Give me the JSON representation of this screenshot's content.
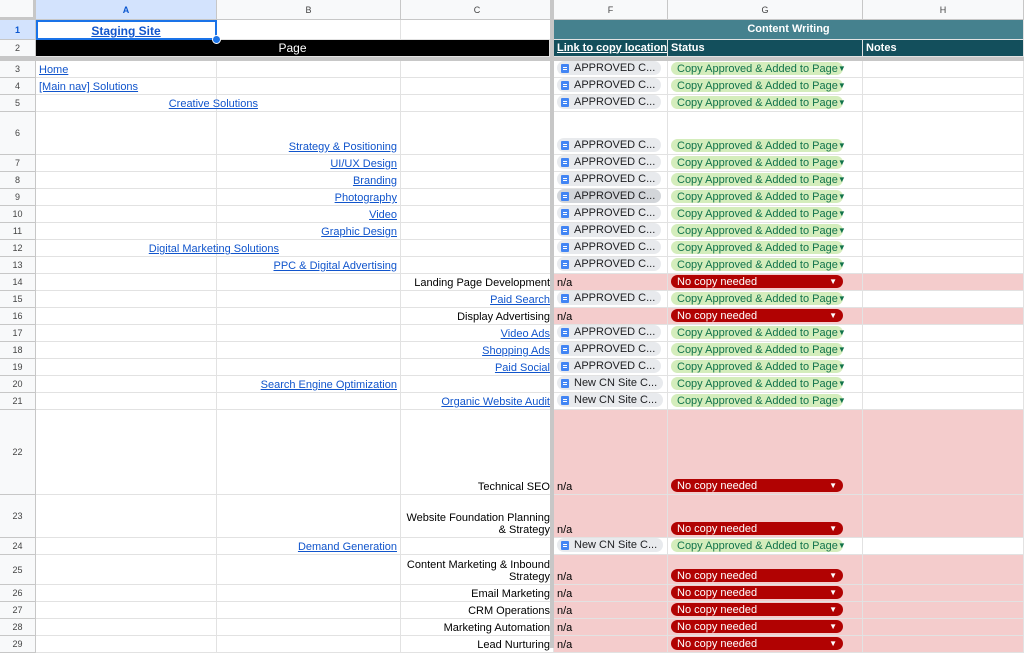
{
  "colors": {
    "header_teal": "#134f5c",
    "header_teal_light": "#45818e",
    "pink": "#f4cccc",
    "green_chip": "#d4edbc",
    "red_chip": "#b10202"
  },
  "columns": [
    "A",
    "B",
    "C",
    "F",
    "G",
    "H"
  ],
  "header": {
    "staging_site": "Staging Site",
    "page": "Page",
    "content_writing": "Content Writing",
    "link_to_copy": "Link to copy location",
    "status": "Status",
    "notes": "Notes"
  },
  "rows": [
    {
      "num": "3",
      "a": "Home",
      "b": "",
      "c": "",
      "link": "APPROVED C...",
      "status": "Copy Approved & Added to Page",
      "kind": "ok"
    },
    {
      "num": "4",
      "a": "[Main nav] Solutions",
      "b": "",
      "c": "",
      "link": "APPROVED C...",
      "status": "Copy Approved & Added to Page",
      "kind": "ok"
    },
    {
      "num": "5",
      "a": "Creative Solutions",
      "b": "",
      "c": "",
      "link": "APPROVED C...",
      "status": "Copy Approved & Added to Page",
      "kind": "ok"
    },
    {
      "num": "6",
      "a": "",
      "b": "Strategy & Positioning",
      "c": "",
      "link": "APPROVED C...",
      "status": "Copy Approved & Added to Page",
      "kind": "ok"
    },
    {
      "num": "7",
      "a": "",
      "b": "UI/UX Design",
      "c": "",
      "link": "APPROVED C...",
      "status": "Copy Approved & Added to Page",
      "kind": "ok"
    },
    {
      "num": "8",
      "a": "",
      "b": "Branding",
      "c": "",
      "link": "APPROVED C...",
      "status": "Copy Approved & Added to Page",
      "kind": "ok"
    },
    {
      "num": "9",
      "a": "",
      "b": "Photography",
      "c": "",
      "link": "APPROVED C...",
      "status": "Copy Approved & Added to Page",
      "kind": "ok"
    },
    {
      "num": "10",
      "a": "",
      "b": "Video",
      "c": "",
      "link": "APPROVED C...",
      "status": "Copy Approved & Added to Page",
      "kind": "ok"
    },
    {
      "num": "11",
      "a": "",
      "b": "Graphic Design",
      "c": "",
      "link": "APPROVED C...",
      "status": "Copy Approved & Added to Page",
      "kind": "ok"
    },
    {
      "num": "12",
      "a": "Digital Marketing Solutions",
      "b": "",
      "c": "",
      "link": "APPROVED C...",
      "status": "Copy Approved & Added to Page",
      "kind": "ok"
    },
    {
      "num": "13",
      "a": "",
      "b": "PPC & Digital Advertising",
      "c": "",
      "link": "APPROVED C...",
      "status": "Copy Approved & Added to Page",
      "kind": "ok"
    },
    {
      "num": "14",
      "a": "",
      "b": "",
      "c": "Landing Page Development",
      "link": "n/a",
      "status": "No copy needed",
      "kind": "no"
    },
    {
      "num": "15",
      "a": "",
      "b": "",
      "c": "Paid Search",
      "link": "APPROVED C...",
      "status": "Copy Approved & Added to Page",
      "kind": "ok"
    },
    {
      "num": "16",
      "a": "",
      "b": "",
      "c": "Display Advertising",
      "link": "n/a",
      "status": "No copy needed",
      "kind": "no"
    },
    {
      "num": "17",
      "a": "",
      "b": "",
      "c": "Video Ads",
      "link": "APPROVED C...",
      "status": "Copy Approved & Added to Page",
      "kind": "ok"
    },
    {
      "num": "18",
      "a": "",
      "b": "",
      "c": "Shopping Ads",
      "link": "APPROVED C...",
      "status": "Copy Approved & Added to Page",
      "kind": "ok"
    },
    {
      "num": "19",
      "a": "",
      "b": "",
      "c": "Paid Social",
      "link": "APPROVED C...",
      "status": "Copy Approved & Added to Page",
      "kind": "ok"
    },
    {
      "num": "20",
      "a": "",
      "b": "Search Engine Optimization",
      "c": "",
      "link": "New CN Site C...",
      "status": "Copy Approved & Added to Page",
      "kind": "ok"
    },
    {
      "num": "21",
      "a": "",
      "b": "",
      "c": "Organic Website Audit",
      "link": "New CN Site C...",
      "status": "Copy Approved & Added to Page",
      "kind": "ok"
    },
    {
      "num": "22",
      "a": "",
      "b": "",
      "c": "Technical SEO",
      "link": "n/a",
      "status": "No copy needed",
      "kind": "no"
    },
    {
      "num": "23",
      "a": "",
      "b": "",
      "c": "Website Foundation Planning\n& Strategy",
      "link": "n/a",
      "status": "No copy needed",
      "kind": "no"
    },
    {
      "num": "24",
      "a": "",
      "b": "Demand Generation",
      "c": "",
      "link": "New CN Site C...",
      "status": "Copy Approved & Added to Page",
      "kind": "ok"
    },
    {
      "num": "25",
      "a": "",
      "b": "",
      "c": "Content Marketing & Inbound\nStrategy",
      "link": "n/a",
      "status": "No copy needed",
      "kind": "no"
    },
    {
      "num": "26",
      "a": "",
      "b": "",
      "c": "Email Marketing",
      "link": "n/a",
      "status": "No copy needed",
      "kind": "no"
    },
    {
      "num": "27",
      "a": "",
      "b": "",
      "c": "CRM Operations",
      "link": "n/a",
      "status": "No copy needed",
      "kind": "no"
    },
    {
      "num": "28",
      "a": "",
      "b": "",
      "c": "Marketing Automation",
      "link": "n/a",
      "status": "No copy needed",
      "kind": "no"
    },
    {
      "num": "29",
      "a": "",
      "b": "",
      "c": "Lead Nurturing",
      "link": "n/a",
      "status": "No copy needed",
      "kind": "no"
    }
  ]
}
